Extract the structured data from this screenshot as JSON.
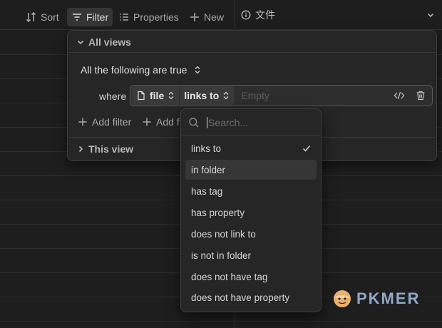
{
  "toolbar": {
    "sort_label": "Sort",
    "filter_label": "Filter",
    "properties_label": "Properties",
    "new_label": "New"
  },
  "column": {
    "title": "文件"
  },
  "panel": {
    "all_views_label": "All views",
    "conjunction": "All the following are true",
    "where_label": "where",
    "condition": {
      "property": "file",
      "operator": "links to",
      "value_placeholder": "Empty"
    },
    "add_filter_label": "Add filter",
    "add_filter_group_label": "Add f",
    "this_view_label": "This view"
  },
  "dropdown": {
    "search_placeholder": "Search...",
    "options": [
      {
        "label": "links to",
        "selected": true
      },
      {
        "label": "in folder",
        "hover": true
      },
      {
        "label": "has tag"
      },
      {
        "label": "has property"
      },
      {
        "label": "does not link to"
      },
      {
        "label": "is not in folder"
      },
      {
        "label": "does not have tag"
      },
      {
        "label": "does not have property"
      }
    ]
  },
  "watermark": {
    "text": "PKMER"
  }
}
